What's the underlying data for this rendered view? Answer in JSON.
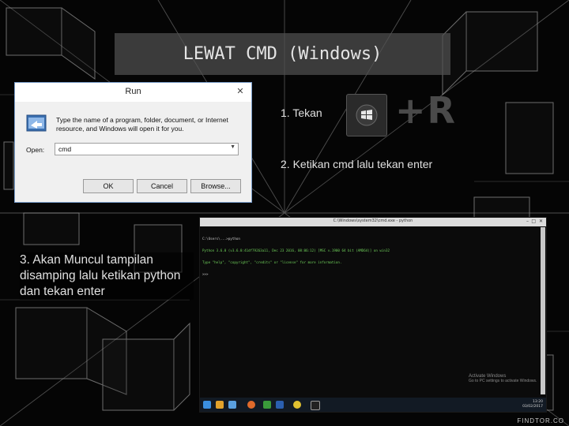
{
  "title": "LEWAT CMD (Windows)",
  "run_dialog": {
    "window_title": "Run",
    "close_glyph": "✕",
    "description": "Type the name of a program, folder, document, or Internet resource, and Windows will open it for you.",
    "open_label": "Open:",
    "open_value": "cmd",
    "buttons": {
      "ok": "OK",
      "cancel": "Cancel",
      "browse": "Browse..."
    }
  },
  "steps": {
    "step1": "1. Tekan",
    "step2": "2. Ketikan cmd lalu tekan enter",
    "step3": "3. Akan Muncul tampilan disamping lalu ketikan python dan tekan enter"
  },
  "hotkey": {
    "key_icon": "windows-logo-icon",
    "text": "+R"
  },
  "cmd_window": {
    "title": "C:\\Windows\\system32\\cmd.exe - python",
    "lines": [
      "C:\\Users\\...>python",
      "Python 3.6.0 (v3.6.0:41df79263a11, Dec 23 2016, 08:06:12) [MSC v.1900 64 bit (AMD64)] on win32",
      "Type \"help\", \"copyright\", \"credits\" or \"license\" for more information.",
      ">>> "
    ],
    "watermark_line1": "Activate Windows",
    "watermark_line2": "Go to PC settings to activate Windows.",
    "clock_time": "13:20",
    "clock_date": "03/02/2017"
  },
  "footer": "FINDTOR.CO",
  "colors": {
    "prompt_text": "#c8c8c8",
    "accent_green": "#6fcf5a"
  }
}
